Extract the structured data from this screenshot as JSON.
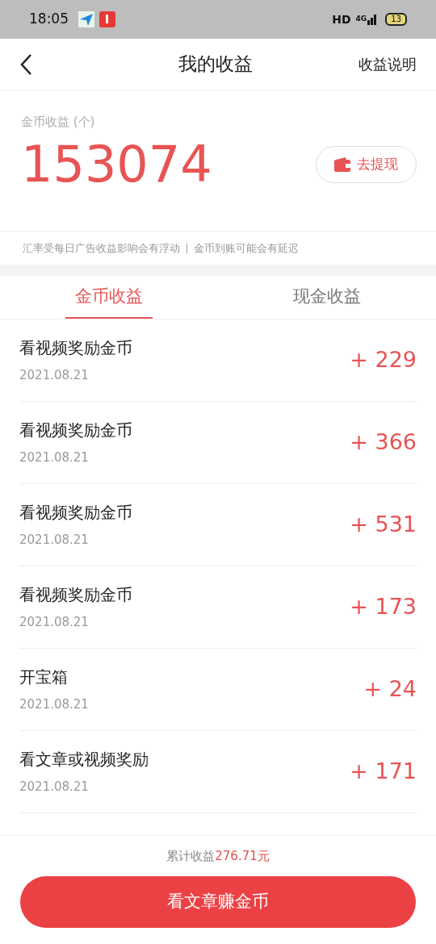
{
  "status_bar": {
    "time": "18:05",
    "hd": "HD",
    "network": "4G",
    "battery": "13"
  },
  "header": {
    "title": "我的收益",
    "action": "收益说明"
  },
  "balance": {
    "label": "金币收益 (个)",
    "value": "153074",
    "withdraw": "去提现"
  },
  "notice": [
    "汇率受每日广告收益影响会有浮动",
    "金币到账可能会有延迟"
  ],
  "tabs": [
    {
      "label": "金币收益",
      "selected": true
    },
    {
      "label": "现金收益",
      "selected": false
    }
  ],
  "records": [
    {
      "title": "看视频奖励金币",
      "date": "2021.08.21",
      "amount": "+ 229"
    },
    {
      "title": "看视频奖励金币",
      "date": "2021.08.21",
      "amount": "+ 366"
    },
    {
      "title": "看视频奖励金币",
      "date": "2021.08.21",
      "amount": "+ 531"
    },
    {
      "title": "看视频奖励金币",
      "date": "2021.08.21",
      "amount": "+ 173"
    },
    {
      "title": "开宝箱",
      "date": "2021.08.21",
      "amount": "+ 24"
    },
    {
      "title": "看文章或视频奖励",
      "date": "2021.08.21",
      "amount": "+ 171"
    }
  ],
  "footer": {
    "total_label": "累计收益",
    "total_value": "276.71元",
    "button": "看文章赚金币"
  }
}
